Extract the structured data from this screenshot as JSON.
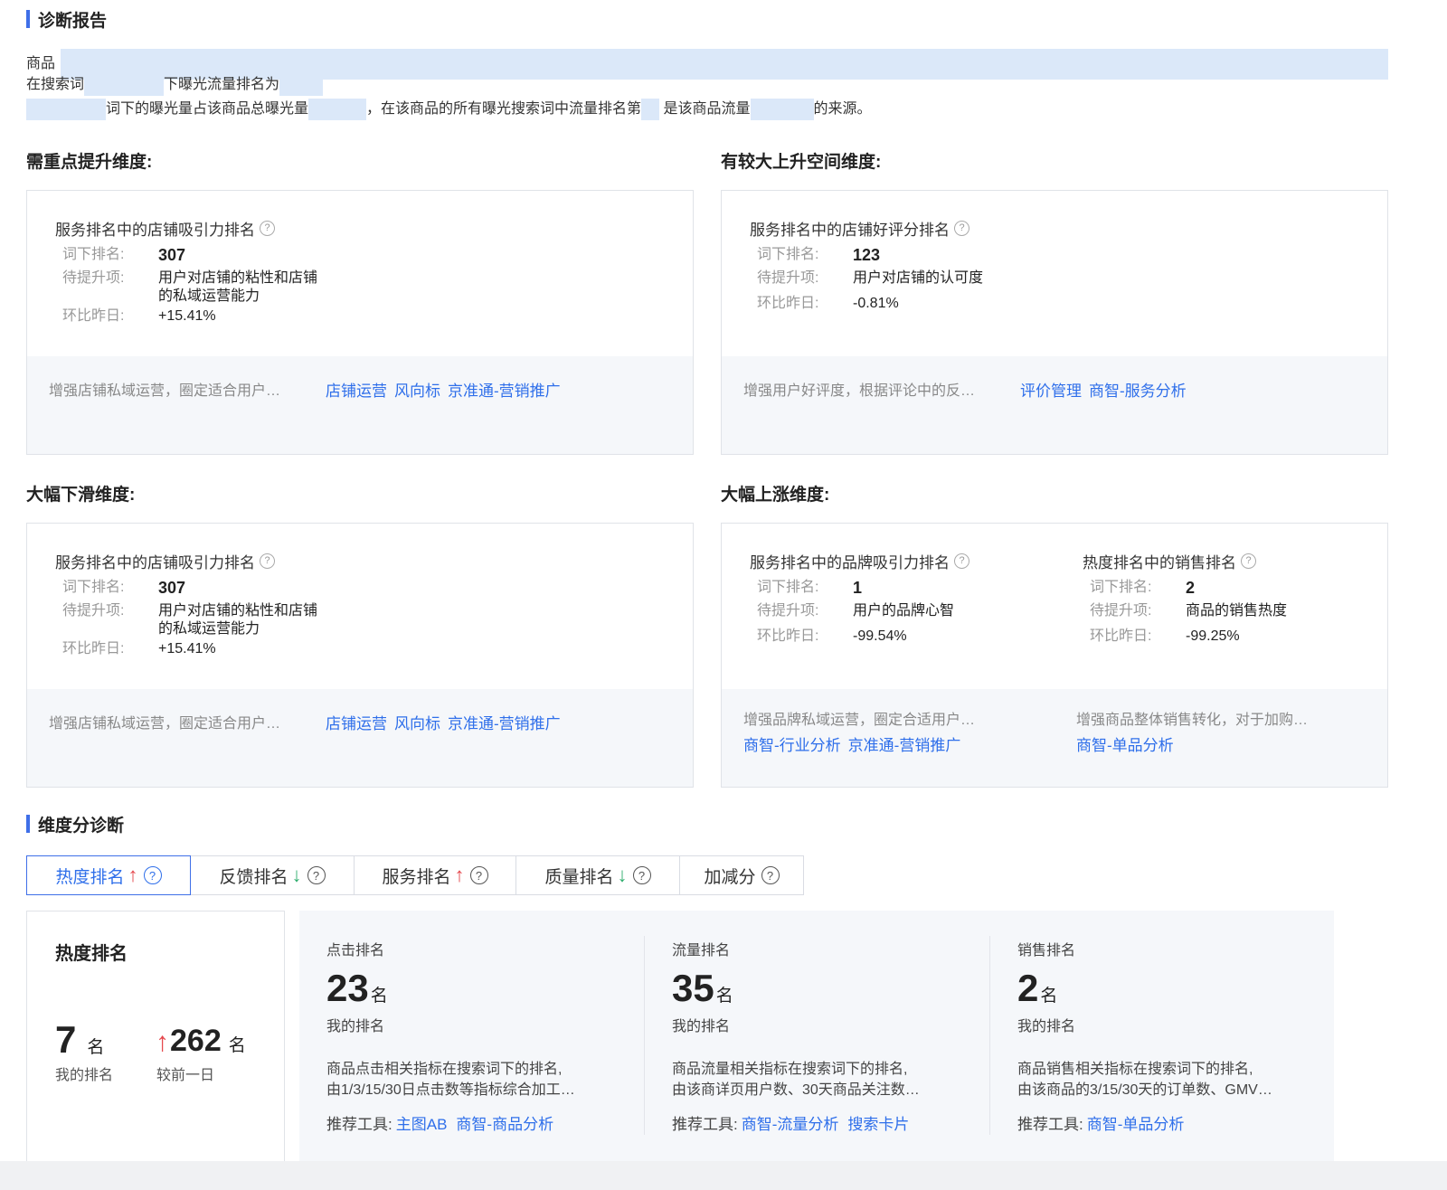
{
  "report": {
    "title": "诊断报告",
    "intro": {
      "line1_prefix": "商品",
      "line2_a": "在搜索词",
      "line2_b": "下曝光流量排名为",
      "line3_a": "词下的曝光量占该商品总曝光量",
      "line3_b": "，在该商品的所有曝光搜索词中流量排名第",
      "line3_c": "是该商品流量",
      "line3_d": "的来源。"
    }
  },
  "labels": {
    "row_rank": "词下排名:",
    "row_improve": "待提升项:",
    "row_change": "环比昨日:",
    "help_glyph": "?"
  },
  "groups": {
    "focus": {
      "label": "需重点提升维度:",
      "metric_title": "服务排名中的店铺吸引力排名",
      "rank": "307",
      "improve_l1": "用户对店铺的粘性和店铺",
      "improve_l2": "的私域运营能力",
      "change": "+15.41%",
      "tip": "增强店铺私域运营，圈定适合用户…",
      "links": [
        "店铺运营",
        "风向标",
        "京准通-营销推广"
      ]
    },
    "room": {
      "label": "有较大上升空间维度:",
      "metric_title": "服务排名中的店铺好评分排名",
      "rank": "123",
      "improve": "用户对店铺的认可度",
      "change": "-0.81%",
      "tip": "增强用户好评度，根据评论中的反…",
      "links": [
        "评价管理",
        "商智-服务分析"
      ]
    },
    "drop": {
      "label": "大幅下滑维度:",
      "metric_title": "服务排名中的店铺吸引力排名",
      "rank": "307",
      "improve_l1": "用户对店铺的粘性和店铺",
      "improve_l2": "的私域运营能力",
      "change": "+15.41%",
      "tip": "增强店铺私域运营，圈定适合用户…",
      "links": [
        "店铺运营",
        "风向标",
        "京准通-营销推广"
      ]
    },
    "rise": {
      "label": "大幅上涨维度:",
      "a": {
        "metric_title": "服务排名中的品牌吸引力排名",
        "rank": "1",
        "improve": "用户的品牌心智",
        "change": "-99.54%",
        "tip": "增强品牌私域运营，圈定合适用户…",
        "links": [
          "商智-行业分析",
          "京准通-营销推广"
        ]
      },
      "b": {
        "metric_title": "热度排名中的销售排名",
        "rank": "2",
        "improve": "商品的销售热度",
        "change": "-99.25%",
        "tip": "增强商品整体销售转化，对于加购…",
        "links": [
          "商智-单品分析"
        ]
      }
    }
  },
  "dimension": {
    "title": "维度分诊断",
    "tabs": [
      {
        "label": "热度排名",
        "arrow": "↑"
      },
      {
        "label": "反馈排名",
        "arrow": "↓"
      },
      {
        "label": "服务排名",
        "arrow": "↑"
      },
      {
        "label": "质量排名",
        "arrow": "↓"
      },
      {
        "label": "加减分",
        "arrow": ""
      }
    ],
    "heat": {
      "title": "热度排名",
      "my_rank": "7",
      "my_rank_unit": "名",
      "my_rank_caption": "我的排名",
      "change_arrow": "↑",
      "change_value": "262",
      "change_unit": "名",
      "change_caption": "较前一日"
    },
    "subs": [
      {
        "title": "点击排名",
        "value": "23",
        "unit": "名",
        "caption": "我的排名",
        "desc_l1": "商品点击相关指标在搜索词下的排名,",
        "desc_l2": "由1/3/15/30日点击数等指标综合加工…",
        "tools_label": "推荐工具:",
        "tools": [
          "主图AB",
          "商智-商品分析"
        ]
      },
      {
        "title": "流量排名",
        "value": "35",
        "unit": "名",
        "caption": "我的排名",
        "desc_l1": "商品流量相关指标在搜索词下的排名,",
        "desc_l2": "由该商详页用户数、30天商品关注数…",
        "tools_label": "推荐工具:",
        "tools": [
          "商智-流量分析",
          "搜索卡片"
        ]
      },
      {
        "title": "销售排名",
        "value": "2",
        "unit": "名",
        "caption": "我的排名",
        "desc_l1": "商品销售相关指标在搜索词下的排名,",
        "desc_l2": "由该商品的3/15/30天的订单数、GMV…",
        "tools_label": "推荐工具:",
        "tools": [
          "商智-单品分析"
        ]
      }
    ]
  }
}
